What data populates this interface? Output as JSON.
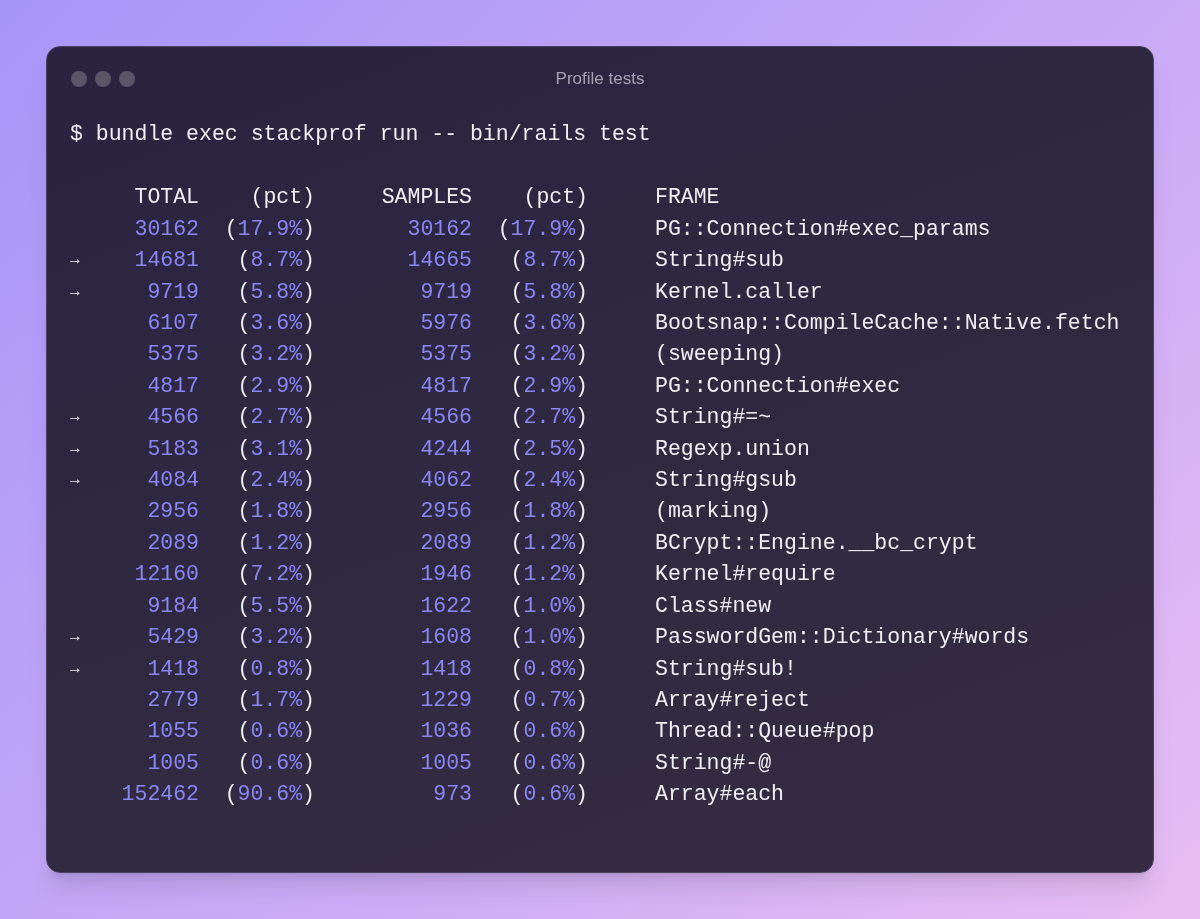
{
  "window": {
    "title": "Profile tests"
  },
  "command": "$ bundle exec stackprof run -- bin/rails test",
  "columns": [
    "TOTAL",
    "(pct)",
    "SAMPLES",
    "(pct)",
    "FRAME"
  ],
  "rows": [
    {
      "total": "30162",
      "total_pct": "(17.9%)",
      "samples": "30162",
      "samples_pct": "(17.9%)",
      "frame": "PG::Connection#exec_params"
    },
    {
      "marker": "→",
      "total": "14681",
      "total_pct": "(8.7%)",
      "samples": "14665",
      "samples_pct": "(8.7%)",
      "frame": "String#sub"
    },
    {
      "marker": "→",
      "total": "9719",
      "total_pct": "(5.8%)",
      "samples": "9719",
      "samples_pct": "(5.8%)",
      "frame": "Kernel.caller"
    },
    {
      "total": "6107",
      "total_pct": "(3.6%)",
      "samples": "5976",
      "samples_pct": "(3.6%)",
      "frame": "Bootsnap::CompileCache::Native.fetch"
    },
    {
      "total": "5375",
      "total_pct": "(3.2%)",
      "samples": "5375",
      "samples_pct": "(3.2%)",
      "frame": "(sweeping)"
    },
    {
      "total": "4817",
      "total_pct": "(2.9%)",
      "samples": "4817",
      "samples_pct": "(2.9%)",
      "frame": "PG::Connection#exec"
    },
    {
      "marker": "→",
      "total": "4566",
      "total_pct": "(2.7%)",
      "samples": "4566",
      "samples_pct": "(2.7%)",
      "frame": "String#=~"
    },
    {
      "marker": "→",
      "total": "5183",
      "total_pct": "(3.1%)",
      "samples": "4244",
      "samples_pct": "(2.5%)",
      "frame": "Regexp.union"
    },
    {
      "marker": "→",
      "total": "4084",
      "total_pct": "(2.4%)",
      "samples": "4062",
      "samples_pct": "(2.4%)",
      "frame": "String#gsub"
    },
    {
      "total": "2956",
      "total_pct": "(1.8%)",
      "samples": "2956",
      "samples_pct": "(1.8%)",
      "frame": "(marking)"
    },
    {
      "total": "2089",
      "total_pct": "(1.2%)",
      "samples": "2089",
      "samples_pct": "(1.2%)",
      "frame": "BCrypt::Engine.__bc_crypt"
    },
    {
      "total": "12160",
      "total_pct": "(7.2%)",
      "samples": "1946",
      "samples_pct": "(1.2%)",
      "frame": "Kernel#require"
    },
    {
      "total": "9184",
      "total_pct": "(5.5%)",
      "samples": "1622",
      "samples_pct": "(1.0%)",
      "frame": "Class#new"
    },
    {
      "marker": "→",
      "total": "5429",
      "total_pct": "(3.2%)",
      "samples": "1608",
      "samples_pct": "(1.0%)",
      "frame": "PasswordGem::Dictionary#words"
    },
    {
      "marker": "→",
      "total": "1418",
      "total_pct": "(0.8%)",
      "samples": "1418",
      "samples_pct": "(0.8%)",
      "frame": "String#sub!"
    },
    {
      "total": "2779",
      "total_pct": "(1.7%)",
      "samples": "1229",
      "samples_pct": "(0.7%)",
      "frame": "Array#reject"
    },
    {
      "total": "1055",
      "total_pct": "(0.6%)",
      "samples": "1036",
      "samples_pct": "(0.6%)",
      "frame": "Thread::Queue#pop"
    },
    {
      "total": "1005",
      "total_pct": "(0.6%)",
      "samples": "1005",
      "samples_pct": "(0.6%)",
      "frame": "String#-@"
    },
    {
      "total": "152462",
      "total_pct": "(90.6%)",
      "samples": "973",
      "samples_pct": "(0.6%)",
      "frame": "Array#each"
    }
  ]
}
